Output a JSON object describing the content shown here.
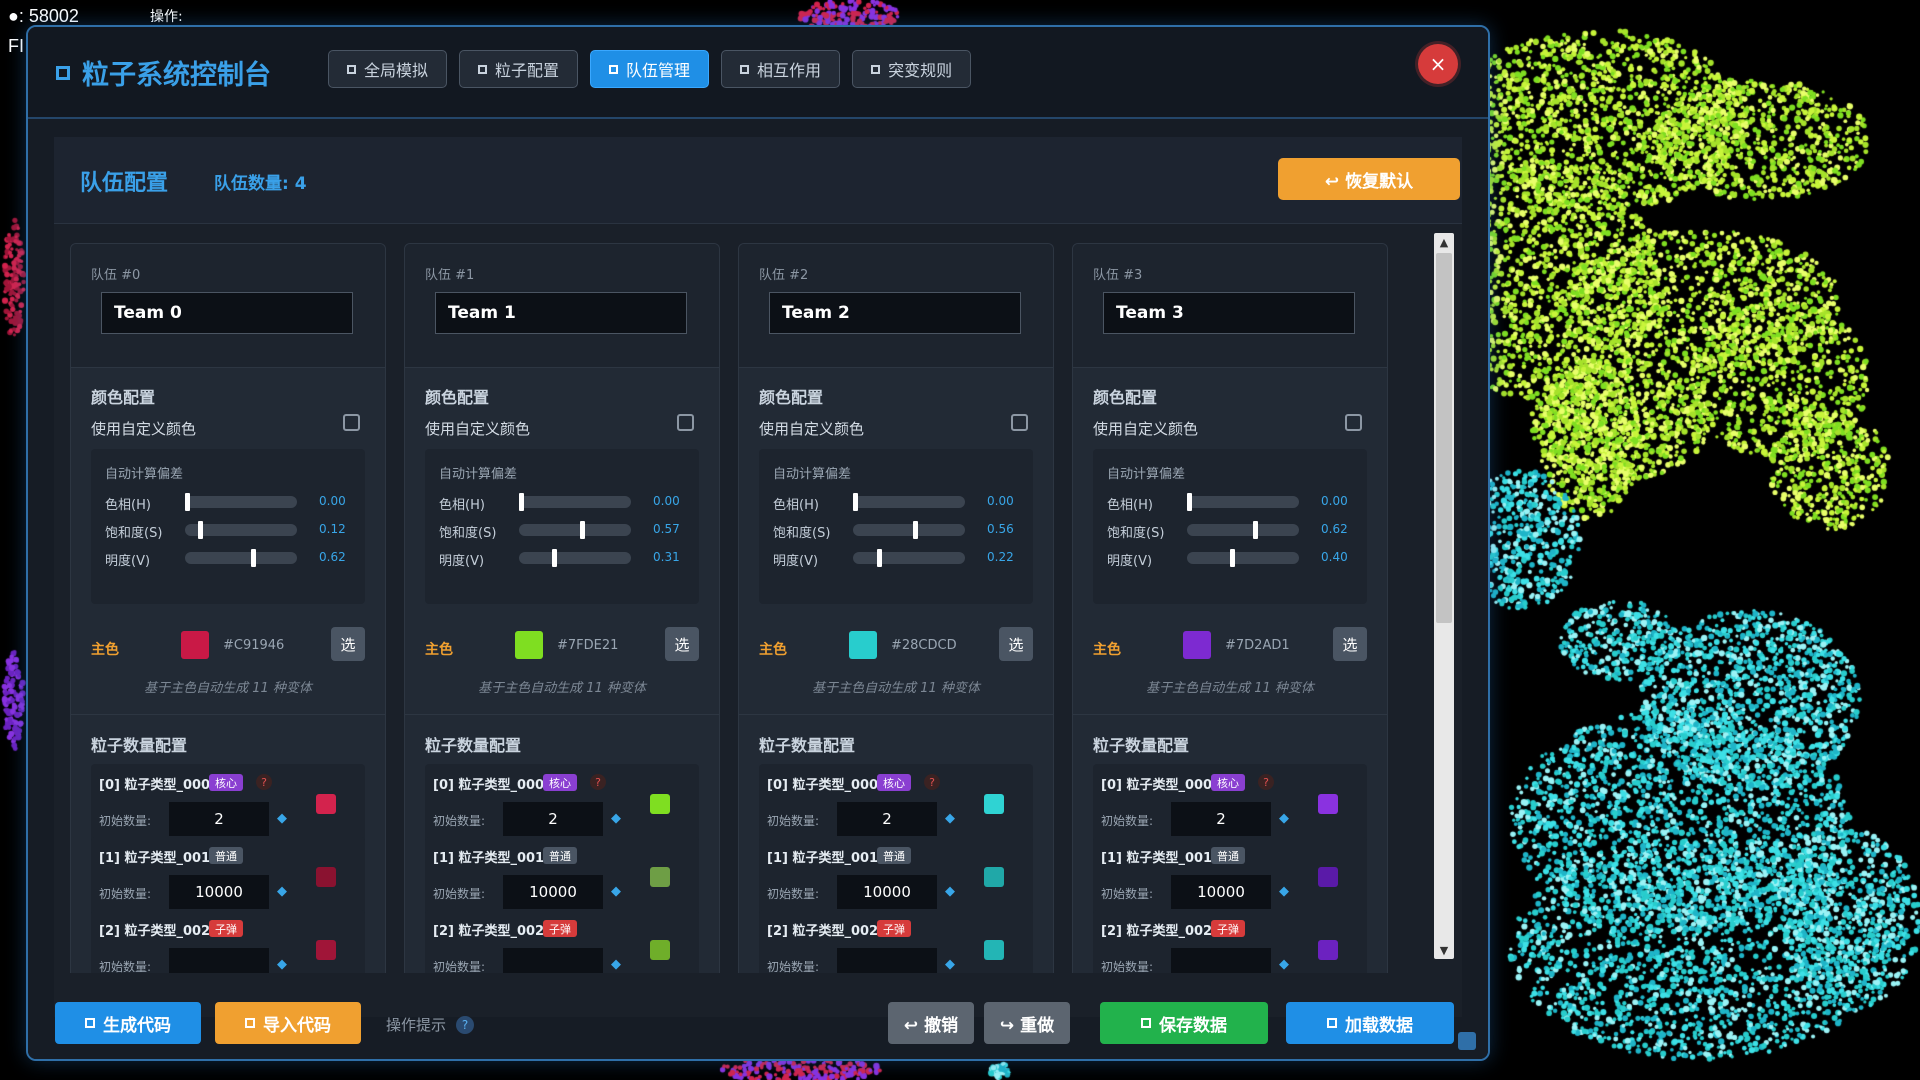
{
  "hud": {
    "fps_line": "●: 58002",
    "fr_line": "FI",
    "operation": "操作:"
  },
  "window": {
    "title": "粒子系统控制台",
    "close_label": "×"
  },
  "tabs": [
    {
      "label": "全局模拟"
    },
    {
      "label": "粒子配置"
    },
    {
      "label": "队伍管理",
      "active": true
    },
    {
      "label": "相互作用"
    },
    {
      "label": "突变规则"
    }
  ],
  "panel": {
    "title": "队伍配置",
    "team_count": "队伍数量: 4",
    "reset_label": "↩ 恢复默认"
  },
  "labels": {
    "color_config": "颜色配置",
    "use_custom_color": "使用自定义颜色",
    "auto_offset": "自动计算偏差",
    "hue": "色相(H)",
    "saturation": "饱和度(S)",
    "value": "明度(V)",
    "main_color": "主色",
    "pick": "选",
    "variants_note": "基于主色自动生成 11 种变体",
    "particle_count_config": "粒子数量配置",
    "initial_count": "初始数量:",
    "question": "?"
  },
  "teams": [
    {
      "label": "队伍 #0",
      "name": "Team 0",
      "h": "0.00",
      "s": "0.12",
      "v": "0.62",
      "hex": "#C91946",
      "color": "#C91946",
      "particles": [
        {
          "name": "[0] 粒子类型_000",
          "tag": "核心",
          "tag_type": "core",
          "count": "2",
          "color": "#d3234d"
        },
        {
          "name": "[1] 粒子类型_001",
          "tag": "普通",
          "tag_type": "normal",
          "count": "10000",
          "color": "#8a1230"
        },
        {
          "name": "[2] 粒子类型_002",
          "tag": "子弹",
          "tag_type": "bullet",
          "count": "",
          "color": "#a01538"
        }
      ]
    },
    {
      "label": "队伍 #1",
      "name": "Team 1",
      "h": "0.00",
      "s": "0.57",
      "v": "0.31",
      "hex": "#7FDE21",
      "color": "#7FDE21",
      "particles": [
        {
          "name": "[0] 粒子类型_000",
          "tag": "核心",
          "tag_type": "core",
          "count": "2",
          "color": "#7fde21"
        },
        {
          "name": "[1] 粒子类型_001",
          "tag": "普通",
          "tag_type": "normal",
          "count": "10000",
          "color": "#6e9e45"
        },
        {
          "name": "[2] 粒子类型_002",
          "tag": "子弹",
          "tag_type": "bullet",
          "count": "",
          "color": "#6fae2a"
        }
      ]
    },
    {
      "label": "队伍 #2",
      "name": "Team 2",
      "h": "0.00",
      "s": "0.56",
      "v": "0.22",
      "hex": "#28CDCD",
      "color": "#28CDCD",
      "particles": [
        {
          "name": "[0] 粒子类型_000",
          "tag": "核心",
          "tag_type": "core",
          "count": "2",
          "color": "#2fd3d3"
        },
        {
          "name": "[1] 粒子类型_001",
          "tag": "普通",
          "tag_type": "normal",
          "count": "10000",
          "color": "#20a8a8"
        },
        {
          "name": "[2] 粒子类型_002",
          "tag": "子弹",
          "tag_type": "bullet",
          "count": "",
          "color": "#23b5b5"
        }
      ]
    },
    {
      "label": "队伍 #3",
      "name": "Team 3",
      "h": "0.00",
      "s": "0.62",
      "v": "0.40",
      "hex": "#7D2AD1",
      "color": "#7D2AD1",
      "particles": [
        {
          "name": "[0] 粒子类型_000",
          "tag": "核心",
          "tag_type": "core",
          "count": "2",
          "color": "#8a32e0"
        },
        {
          "name": "[1] 粒子类型_001",
          "tag": "普通",
          "tag_type": "normal",
          "count": "10000",
          "color": "#5a1aa8"
        },
        {
          "name": "[2] 粒子类型_002",
          "tag": "子弹",
          "tag_type": "bullet",
          "count": "",
          "color": "#6c22c0"
        }
      ]
    }
  ],
  "bottom": {
    "generate_code": "生成代码",
    "import_code": "导入代码",
    "hint": "操作提示",
    "hint_icon": "?",
    "undo": "↩ 撤销",
    "redo": "↪ 重做",
    "save": "保存数据",
    "load": "加载数据"
  },
  "colors": {
    "accent": "#1f8fe6",
    "orange": "#f0a030",
    "green": "#22b24c",
    "danger": "#d63b3b"
  }
}
